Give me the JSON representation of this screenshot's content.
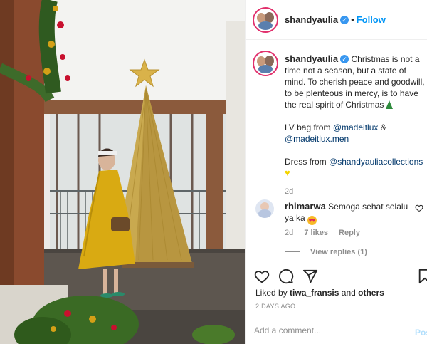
{
  "post": {
    "username": "shandyaulia",
    "follow_label": "Follow",
    "dot": "•",
    "caption": {
      "line1": "Christmas is not a time not a season, but a state of mind. To cherish peace and goodwill, to be plenteous in mercy, is to have the real spirit of Christmas",
      "bag_prefix": "LV bag from",
      "mention1": "@madeitlux",
      "amp": "&",
      "mention2": "@madeitlux.men",
      "dress_prefix": "Dress from",
      "mention3": "@shandyauliacollections",
      "age": "2d"
    },
    "comment": {
      "username": "rhimarwa",
      "text": "Semoga sehat selalu ya ka",
      "age": "2d",
      "likes": "7 likes",
      "reply": "Reply",
      "view_replies": "View replies (1)"
    },
    "liked_by_prefix": "Liked by",
    "liked_by_user": "tiwa_fransis",
    "liked_by_and": "and",
    "liked_by_others": "others",
    "date": "2 DAYS AGO",
    "add_comment_placeholder": "Add a comment...",
    "post_label": "Pos"
  },
  "icons": {
    "verified": "verified-badge-icon",
    "heart": "heart-icon",
    "comment": "comment-icon",
    "share": "share-icon",
    "bookmark": "bookmark-icon"
  },
  "colors": {
    "accent": "#0095f6",
    "verified": "#3897f0",
    "muted": "#8e8e8e",
    "border": "#efefef"
  }
}
